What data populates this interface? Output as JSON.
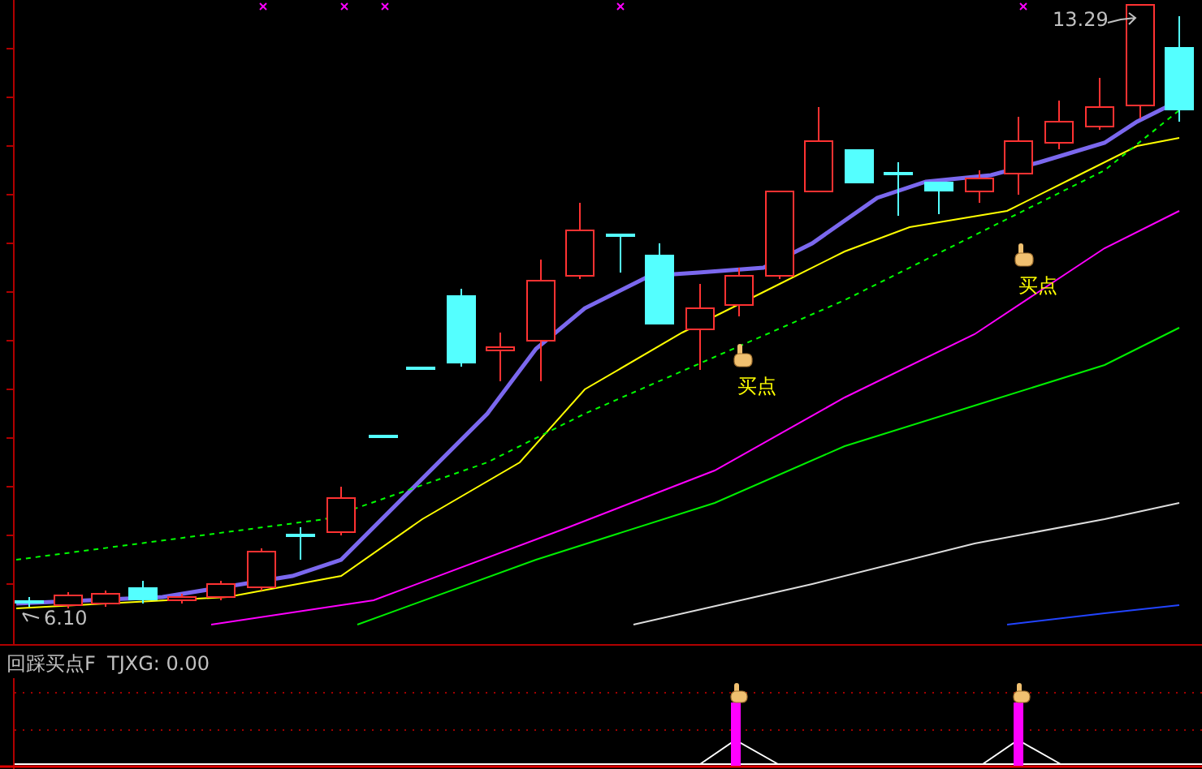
{
  "main_chart": {
    "high_label": "13.29",
    "low_label": "6.10",
    "buy_signals": [
      {
        "label": "买点"
      },
      {
        "label": "买点"
      }
    ]
  },
  "indicator_panel": {
    "name": "回踩买点F",
    "reading": "TJXG: 0.00"
  }
}
